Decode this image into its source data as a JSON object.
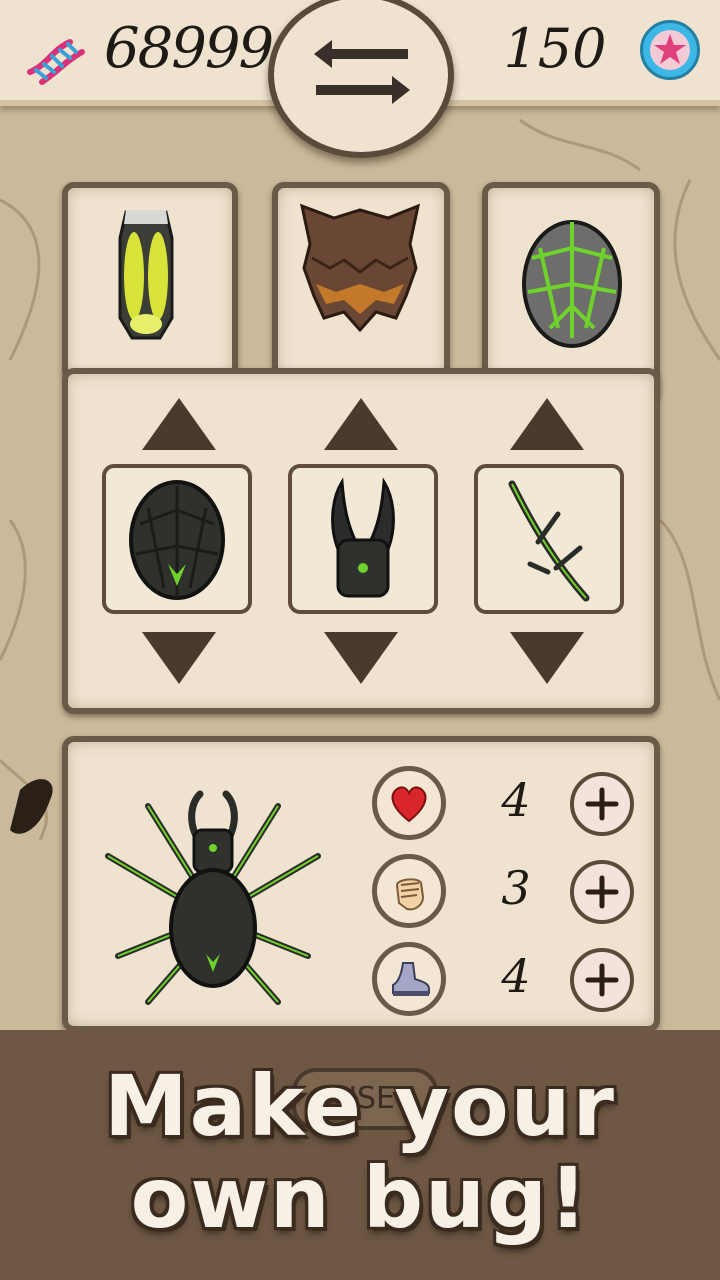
{
  "header": {
    "dna_count": "68999",
    "star_count": "150",
    "icons": {
      "currency": "dna-icon",
      "stars": "star-icon",
      "swap": "swap-arrows-icon"
    }
  },
  "part_tabs": [
    {
      "name": "glowing-yellow-shell"
    },
    {
      "name": "brown-spiked-armor"
    },
    {
      "name": "grey-green-shell"
    }
  ],
  "part_selector": {
    "slots": [
      {
        "part": "body",
        "name": "black-green-shell"
      },
      {
        "part": "head",
        "name": "horned-head"
      },
      {
        "part": "legs",
        "name": "spiked-legs"
      }
    ]
  },
  "stats": [
    {
      "icon": "heart-icon",
      "value": "4"
    },
    {
      "icon": "fist-icon",
      "value": "3"
    },
    {
      "icon": "shoe-icon",
      "value": "4"
    }
  ],
  "use_button": {
    "label": "USE"
  },
  "promo": {
    "line1": "Make your",
    "line2": "own bug!"
  },
  "colors": {
    "paper": "#efe3cf",
    "frame": "#6a5a48",
    "accent_green": "#6fd12c",
    "star_blue": "#3cb7e6",
    "star_pink": "#e0407c"
  }
}
